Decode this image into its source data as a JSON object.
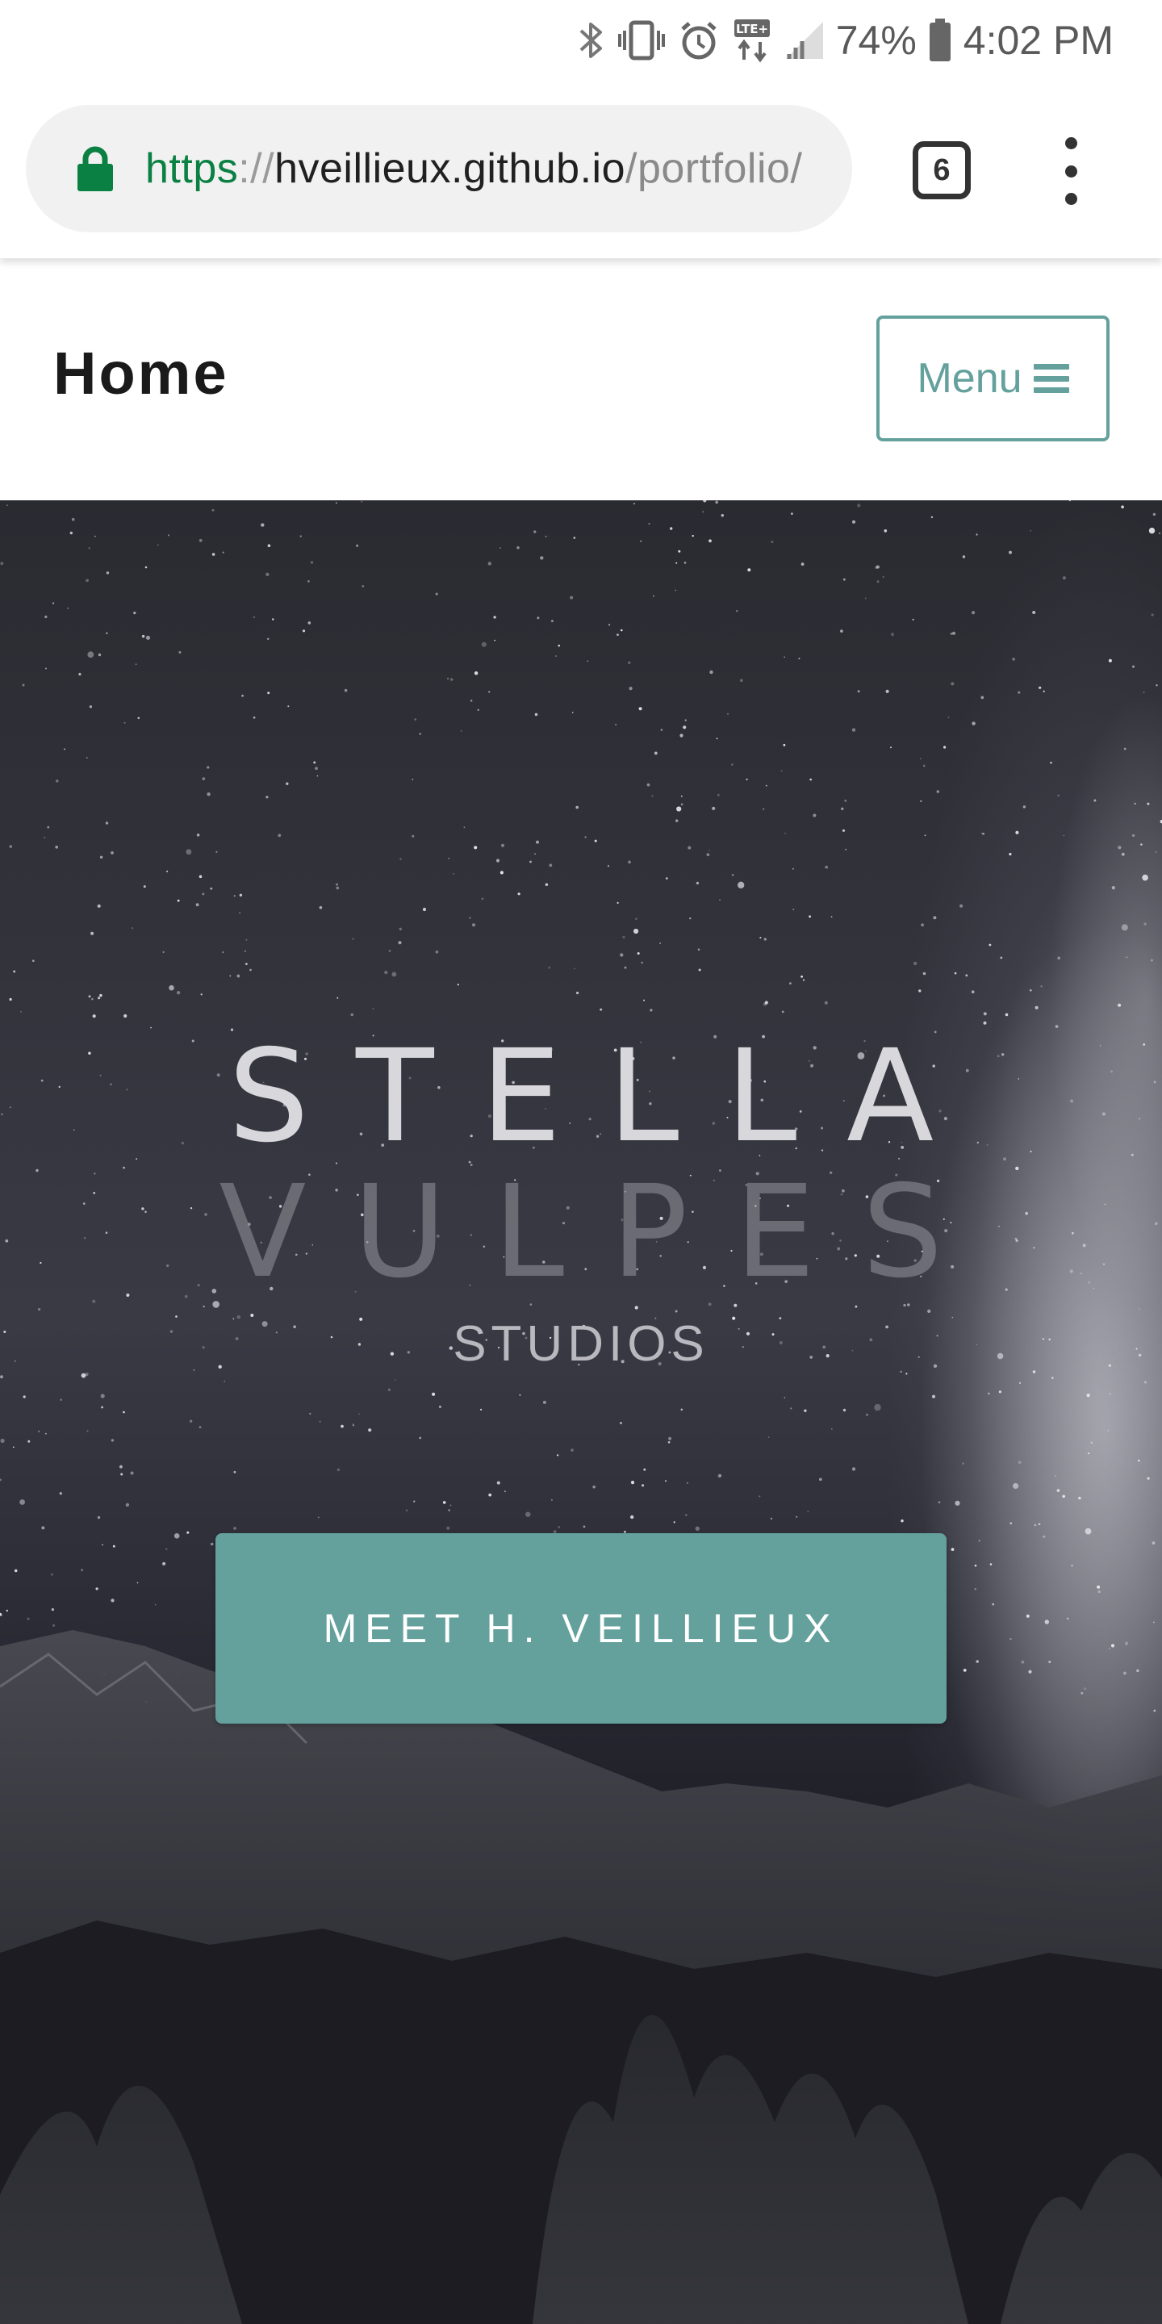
{
  "status_bar": {
    "battery": "74%",
    "time": "4:02 PM",
    "icons": [
      "bluetooth-icon",
      "vibrate-icon",
      "alarm-icon",
      "lte-icon",
      "signal-icon",
      "battery-icon"
    ]
  },
  "browser": {
    "url_scheme": "https",
    "url_separator": "://",
    "url_host": "hveillieux.github.io",
    "url_path": "/portfolio/",
    "tab_count": "6",
    "secure_color": "#0b8043"
  },
  "nav": {
    "brand": "Home",
    "menu_label": "Menu"
  },
  "hero": {
    "title_line_1": "STELLA",
    "title_line_2": "VULPES",
    "subtitle": "STUDIOS",
    "cta_label": "MEET H. VEILLIEUX"
  },
  "colors": {
    "accent": "#64a19d",
    "hero_dark": "#2a2a31"
  }
}
